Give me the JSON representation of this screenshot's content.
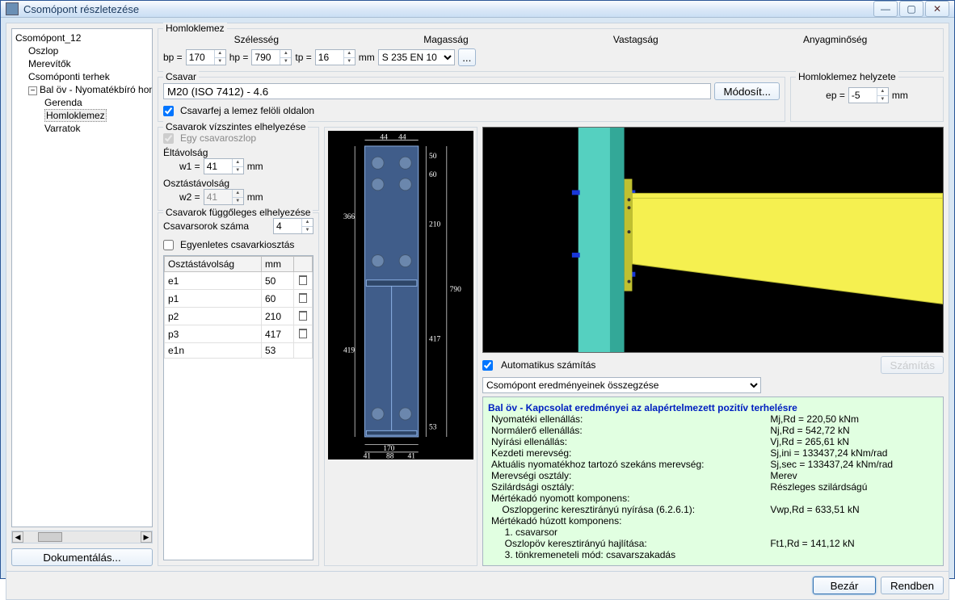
{
  "window": {
    "title": "Csomópont részletezése",
    "btn_min": "—",
    "btn_max": "▢",
    "btn_close": "✕"
  },
  "tree": {
    "root": "Csomópont_12",
    "items": [
      "Oszlop",
      "Merevítők",
      "Csomóponti terhek"
    ],
    "branch": "Bal öv - Nyomatékbíró homlo",
    "branch_items": [
      "Gerenda",
      "Homloklemez",
      "Varratok"
    ],
    "selected": "Homloklemez"
  },
  "doc_btn": "Dokumentálás...",
  "endplate": {
    "legend": "Homloklemez",
    "width_label": "Szélesség",
    "height_label": "Magasság",
    "thick_label": "Vastagság",
    "grade_label": "Anyagminőség",
    "bp_label": "bp =",
    "bp": "170",
    "hp_label": "hp =",
    "hp": "790",
    "tp_label": "tp =",
    "tp": "16",
    "mm": "mm",
    "grade": "S 235 EN 10",
    "more": "..."
  },
  "bolt": {
    "legend": "Csavar",
    "spec": "M20 (ISO 7412) - 4.6",
    "modify": "Módosít...",
    "head_side": "Csavarfej a lemez felöli oldalon"
  },
  "ep_pos": {
    "legend": "Homloklemez helyzete",
    "ep_label": "ep =",
    "ep": "-5",
    "mm": "mm"
  },
  "horiz": {
    "legend": "Csavarok vízszintes elhelyezése",
    "single_col": "Egy csavaroszlop",
    "edge_label": "Éltávolság",
    "w1_label": "w1 =",
    "w1": "41",
    "spacing_label": "Osztástávolság",
    "w2_label": "w2 =",
    "w2": "41",
    "mm": "mm"
  },
  "vert": {
    "legend": "Csavarok függőleges elhelyezése",
    "rows_label": "Csavarsorok száma",
    "rows": "4",
    "uniform": "Egyenletes csavarkiosztás"
  },
  "spacing_table": {
    "col_name": "Osztástávolság",
    "col_mm": "mm",
    "rows": [
      {
        "name": "e1",
        "val": "50",
        "del": true
      },
      {
        "name": "p1",
        "val": "60",
        "del": true
      },
      {
        "name": "p2",
        "val": "210",
        "del": true
      },
      {
        "name": "p3",
        "val": "417",
        "del": true
      },
      {
        "name": "e1n",
        "val": "53",
        "del": false
      }
    ]
  },
  "diagram": {
    "dims": {
      "w": "170",
      "h": "790",
      "nums": [
        "44",
        "44",
        "50",
        "60",
        "366",
        "210",
        "419",
        "417",
        "53",
        "41",
        "88",
        "41"
      ]
    }
  },
  "calc": {
    "auto": "Automatikus számítás",
    "btn": "Számítás"
  },
  "results_dropdown": "Csomópont eredményeinek összegzése",
  "results": {
    "heading": "Bal öv - Kapcsolat eredményei az alapértelmezett pozitív terhelésre",
    "lines": [
      {
        "l": "Nyomatéki ellenállás:",
        "r": "Mj,Rd = 220,50 kNm"
      },
      {
        "l": "Normálerő ellenállás:",
        "r": "Nj,Rd = 542,72 kN"
      },
      {
        "l": "Nyírási ellenállás:",
        "r": "Vj,Rd = 265,61 kN"
      },
      {
        "l": "Kezdeti merevség:",
        "r": "Sj,ini = 133437,24 kNm/rad"
      },
      {
        "l": "Aktuális nyomatékhoz tartozó szekáns merevség:",
        "r": "Sj,sec = 133437,24 kNm/rad"
      },
      {
        "l": "",
        "r": ""
      },
      {
        "l": "Merevségi osztály:",
        "r": "Merev"
      },
      {
        "l": "Szilárdsági osztály:",
        "r": "Részleges szilárdságú"
      },
      {
        "l": "",
        "r": ""
      },
      {
        "l": "Mértékadó nyomott komponens:",
        "r": ""
      },
      {
        "l": "    Oszlopgerinc keresztirányú nyírása (6.2.6.1):",
        "r": "Vwp,Rd = 633,51 kN"
      },
      {
        "l": "Mértékadó húzott komponens:",
        "r": ""
      },
      {
        "l": "     1. csavarsor",
        "r": ""
      },
      {
        "l": "     Oszlopöv keresztirányú hajlítása:",
        "r": "Ft1,Rd = 141,12 kN"
      },
      {
        "l": "     3. tönkremeneteli mód: csavarszakadás",
        "r": ""
      }
    ]
  },
  "footer": {
    "close": "Bezár",
    "ok": "Rendben"
  }
}
